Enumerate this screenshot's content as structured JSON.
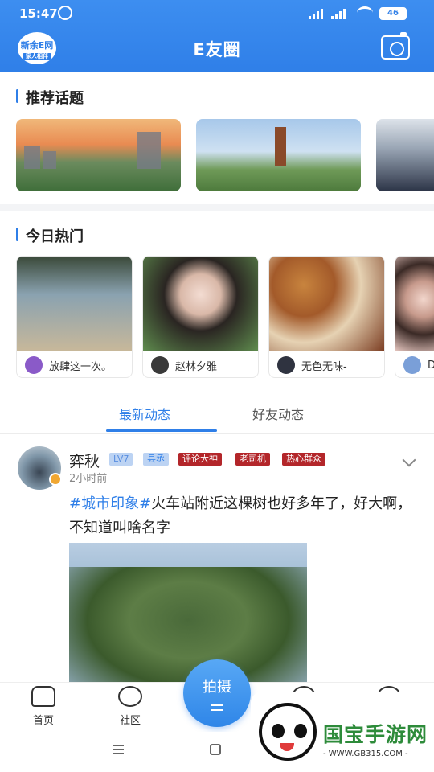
{
  "status_bar": {
    "time": "15:47",
    "battery": "46"
  },
  "header": {
    "logo_text": "新余E网",
    "logo_sub": "家人相伴",
    "title": "E友圈"
  },
  "recommended": {
    "title": "推荐话题"
  },
  "hot": {
    "title": "今日热门",
    "items": [
      {
        "user": "放肆这一次。"
      },
      {
        "user": "赵林夕雅"
      },
      {
        "user": "无色无味-"
      },
      {
        "user": "D"
      }
    ]
  },
  "tabs": [
    {
      "label": "最新动态"
    },
    {
      "label": "好友动态"
    }
  ],
  "post": {
    "username": "弈秋",
    "badges": [
      "LV7",
      "县丞",
      "评论大神",
      "老司机",
      "热心群众"
    ],
    "time": "2小时前",
    "hashtag": "#城市印象#",
    "text": "火车站附近这棵树也好多年了，好大啊，不知道叫啥名字"
  },
  "bottom_nav": {
    "home": "首页",
    "community": "社区",
    "shoot": "拍摄"
  },
  "watermark": {
    "text": "国宝手游网",
    "url": "- WWW.GB315.COM -"
  },
  "colors": {
    "primary": "#2f7fe8",
    "red_badge": "#b3262a"
  }
}
